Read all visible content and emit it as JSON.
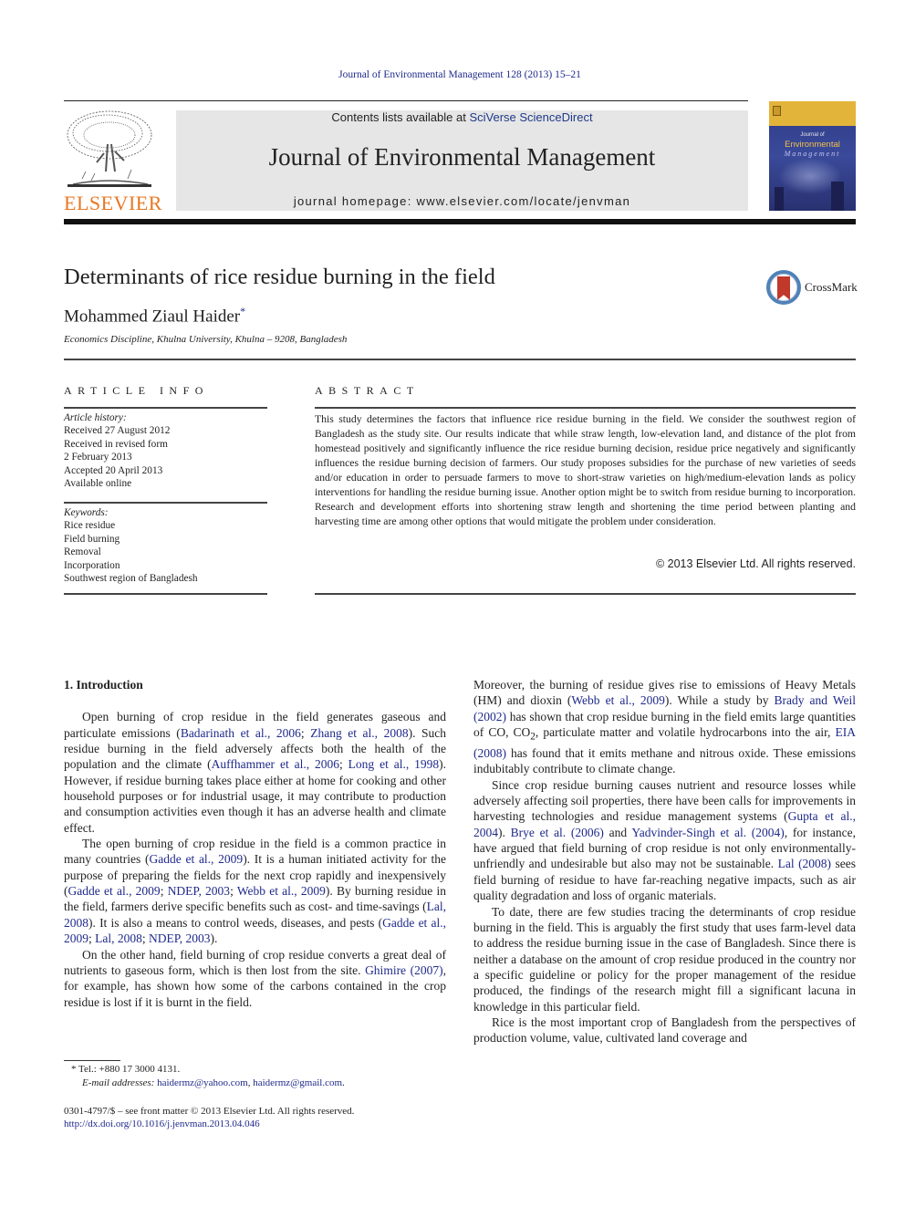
{
  "citation": "Journal of Environmental Management 128 (2013) 15–21",
  "header": {
    "publisher": "ELSEVIER",
    "contents_prefix": "Contents lists available at ",
    "contents_link": "SciVerse ScienceDirect",
    "journal_title": "Journal of Environmental Management",
    "homepage_prefix": "journal homepage: ",
    "homepage_url": "www.elsevier.com/locate/jenvman",
    "cover": {
      "line1": "Journal of",
      "line2": "Environmental",
      "line3": "Management"
    }
  },
  "article": {
    "title": "Determinants of rice residue burning in the field",
    "crossmark": "CrossMark",
    "author": "Mohammed Ziaul Haider",
    "author_mark": "*",
    "affiliation": "Economics Discipline, Khulna University, Khulna – 9208, Bangladesh"
  },
  "article_info": {
    "heading": "ARTICLE INFO",
    "history_label": "Article history:",
    "history": [
      "Received 27 August 2012",
      "Received in revised form",
      "2 February 2013",
      "Accepted 20 April 2013",
      "Available online"
    ],
    "keywords_label": "Keywords:",
    "keywords": [
      "Rice residue",
      "Field burning",
      "Removal",
      "Incorporation",
      "Southwest region of Bangladesh"
    ]
  },
  "abstract": {
    "heading": "ABSTRACT",
    "text": "This study determines the factors that influence rice residue burning in the field. We consider the southwest region of Bangladesh as the study site. Our results indicate that while straw length, low-elevation land, and distance of the plot from homestead positively and significantly influence the rice residue burning decision, residue price negatively and significantly influences the residue burning de­cision of farmers. Our study proposes subsidies for the purchase of new varieties of seeds and/or edu­cation in order to persuade farmers to move to short-straw varieties on high/medium-elevation lands as policy interventions for handling the residue burning issue. Another option might be to switch from residue burning to incorporation. Research and development efforts into shortening straw length and shortening the time period between planting and harvesting time are among other options that would mitigate the problem under consideration.",
    "copyright": "© 2013 Elsevier Ltd. All rights reserved."
  },
  "intro": {
    "heading": "1.  Introduction",
    "p1": [
      {
        "t": "Open burning of crop residue in the field generates gaseous and particulate emissions ("
      },
      {
        "l": "Badarinath et al., 2006"
      },
      {
        "t": "; "
      },
      {
        "l": "Zhang et al., 2008"
      },
      {
        "t": "). Such residue burning in the field adversely affects both the health of the population and the climate ("
      },
      {
        "l": "Auffhammer et al., 2006"
      },
      {
        "t": "; "
      },
      {
        "l": "Long et al., 1998"
      },
      {
        "t": "). However, if residue burning takes place either at home for cooking and other household purposes or for industrial usage, it may contribute to production and consump­tion activities even though it has an adverse health and climate effect."
      }
    ],
    "p2": [
      {
        "t": "The open burning of crop residue in the field is a common practice in many countries ("
      },
      {
        "l": "Gadde et al., 2009"
      },
      {
        "t": "). It is a human initiated activity for the purpose of preparing the fields for the next crop rapidly and inexpensively ("
      },
      {
        "l": "Gadde et al., 2009"
      },
      {
        "t": "; "
      },
      {
        "l": "NDEP, 2003"
      },
      {
        "t": "; "
      },
      {
        "l": "Webb et al., 2009"
      },
      {
        "t": "). By burning residue in the field, farmers derive specific benefits such as cost- and time-savings ("
      },
      {
        "l": "Lal, 2008"
      },
      {
        "t": "). It is also a means to control weeds, diseases, and pests ("
      },
      {
        "l": "Gadde et al., 2009"
      },
      {
        "t": "; "
      },
      {
        "l": "Lal, 2008"
      },
      {
        "t": "; "
      },
      {
        "l": "NDEP, 2003"
      },
      {
        "t": ")."
      }
    ],
    "p3": [
      {
        "t": "On the other hand, field burning of crop residue converts a great deal of nutrients to gaseous form, which is then lost from the site. "
      },
      {
        "l": "Ghimire (2007)"
      },
      {
        "t": ", for example, has shown how some of the carbons contained in the crop residue is lost if it is burnt in the field."
      }
    ],
    "p4": [
      {
        "t": "Moreover, the burning of residue gives rise to emissions of Heavy Metals (HM) and dioxin ("
      },
      {
        "l": "Webb et al., 2009"
      },
      {
        "t": "). While a study by "
      },
      {
        "l": "Brady and Weil (2002)"
      },
      {
        "t": " has shown that crop residue burning in the field emits large quantities of CO, CO"
      },
      {
        "sub": "2"
      },
      {
        "t": ", particulate matter and volatile hydrocarbons into the air, "
      },
      {
        "l": "EIA (2008)"
      },
      {
        "t": " has found that it emits methane and nitrous oxide. These emissions indubitably contribute to climate change."
      }
    ],
    "p5": [
      {
        "t": "Since crop residue burning causes nutrient and resource losses while adversely affecting soil properties, there have been calls for improvements in harvesting technologies and residue manage­ment systems ("
      },
      {
        "l": "Gupta et al., 2004"
      },
      {
        "t": "). "
      },
      {
        "l": "Brye et al. (2006)"
      },
      {
        "t": " and "
      },
      {
        "l": "Yadvinder-Singh et al. (2004)"
      },
      {
        "t": ", for instance, have argued that field burning of crop residue is not only environmentally-unfriendly and undesir­able but also may not be sustainable. "
      },
      {
        "l": "Lal (2008)"
      },
      {
        "t": " sees field burning of residue to have far-reaching negative impacts, such as air quality degradation and loss of organic materials."
      }
    ],
    "p6": [
      {
        "t": "To date, there are few studies tracing the determinants of crop residue burning in the field. This is arguably the first study that uses farm-level data to address the residue burning issue in the case of Bangladesh. Since there is neither a database on the amount of crop residue produced in the country nor a specific guideline or policy for the proper management of the residue produced, the findings of the research might fill a significant lacuna in knowledge in this particular field."
      }
    ],
    "p7": [
      {
        "t": "Rice is the most important crop of Bangladesh from the per­spectives of production volume, value, cultivated land coverage and"
      }
    ]
  },
  "footnotes": {
    "tel": "* Tel.: +880 17 3000 4131.",
    "email_label": "E-mail addresses: ",
    "email1": "haidermz@yahoo.com",
    "email_sep": ", ",
    "email2": "haidermz@gmail.com",
    "email_end": ".",
    "issn": "0301-4797/$ – see front matter © 2013 Elsevier Ltd. All rights reserved.",
    "doi": "http://dx.doi.org/10.1016/j.jenvman.2013.04.046"
  }
}
